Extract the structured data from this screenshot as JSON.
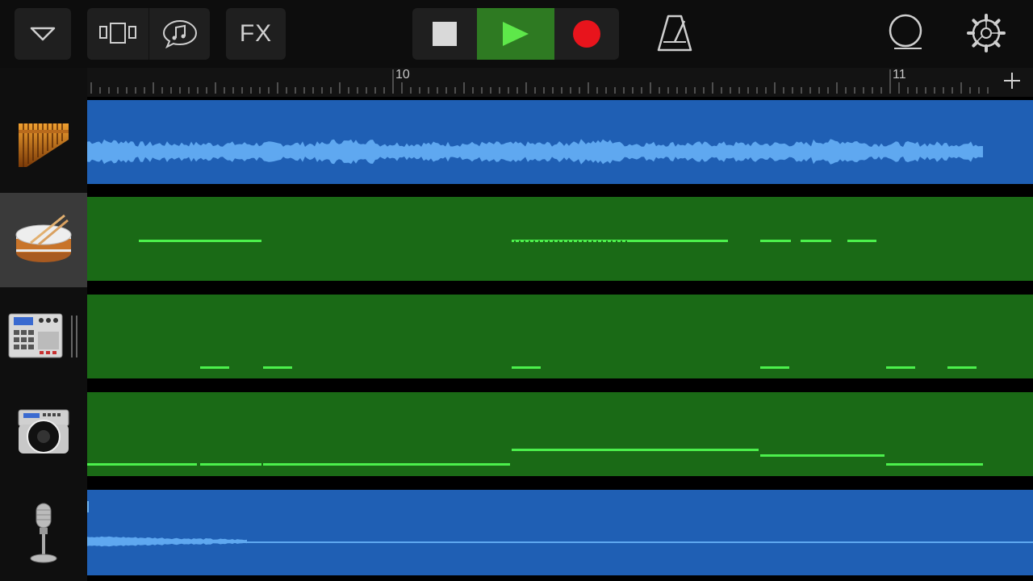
{
  "toolbar": {
    "fx_label": "FX",
    "buttons": [
      "tracks-menu",
      "track-view",
      "browser",
      "fx",
      "stop",
      "play",
      "record",
      "metronome",
      "loop",
      "settings"
    ]
  },
  "ruler": {
    "bar_labels": [
      "10",
      "11"
    ]
  },
  "tracks": [
    {
      "name": "pan-flute",
      "type": "audio",
      "icon": "pan-flute-icon",
      "selected": false
    },
    {
      "name": "drums",
      "type": "midi",
      "icon": "snare-drum-icon",
      "selected": true
    },
    {
      "name": "beat-sequencer",
      "type": "midi",
      "icon": "drum-machine-icon",
      "selected": false
    },
    {
      "name": "bass-synth",
      "type": "midi",
      "icon": "boombox-icon",
      "selected": false
    },
    {
      "name": "vocal",
      "type": "audio",
      "icon": "microphone-icon",
      "selected": false
    }
  ],
  "colors": {
    "audio_region": "#1f5fb4",
    "midi_region": "#1a6a16",
    "midi_note": "#4cf04c",
    "waveform": "#5fa8f0",
    "play_active": "#2e7a22",
    "record": "#e8141c"
  }
}
